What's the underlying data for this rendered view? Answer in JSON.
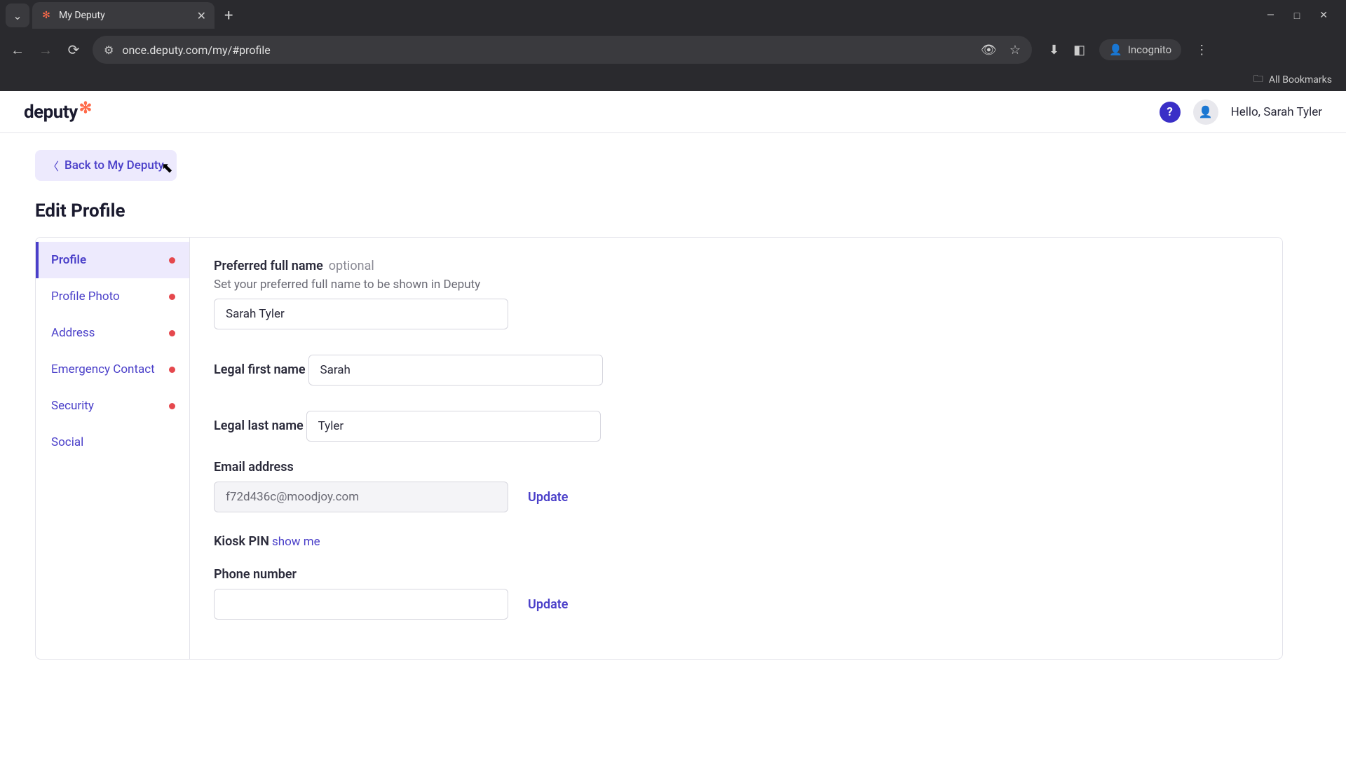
{
  "browser": {
    "tab_title": "My Deputy",
    "url": "once.deputy.com/my/#profile",
    "incognito_label": "Incognito",
    "bookmarks_label": "All Bookmarks"
  },
  "header": {
    "logo_text": "deputy",
    "help_glyph": "?",
    "greeting": "Hello, Sarah Tyler"
  },
  "page": {
    "back_label": "Back to My Deputy",
    "title": "Edit Profile"
  },
  "sidebar": {
    "items": [
      {
        "label": "Profile",
        "active": true,
        "dot": true
      },
      {
        "label": "Profile Photo",
        "active": false,
        "dot": true
      },
      {
        "label": "Address",
        "active": false,
        "dot": true
      },
      {
        "label": "Emergency Contact",
        "active": false,
        "dot": true
      },
      {
        "label": "Security",
        "active": false,
        "dot": true
      },
      {
        "label": "Social",
        "active": false,
        "dot": false
      }
    ]
  },
  "form": {
    "preferred": {
      "label": "Preferred full name",
      "optional": "optional",
      "hint": "Set your preferred full name to be shown in Deputy",
      "value": "Sarah Tyler"
    },
    "first": {
      "label": "Legal first name",
      "value": "Sarah"
    },
    "last": {
      "label": "Legal last name",
      "value": "Tyler"
    },
    "email": {
      "label": "Email address",
      "value": "f72d436c@moodjoy.com",
      "action": "Update"
    },
    "kiosk": {
      "label": "Kiosk PIN",
      "action": "show me"
    },
    "phone": {
      "label": "Phone number",
      "value": "",
      "action": "Update"
    }
  }
}
